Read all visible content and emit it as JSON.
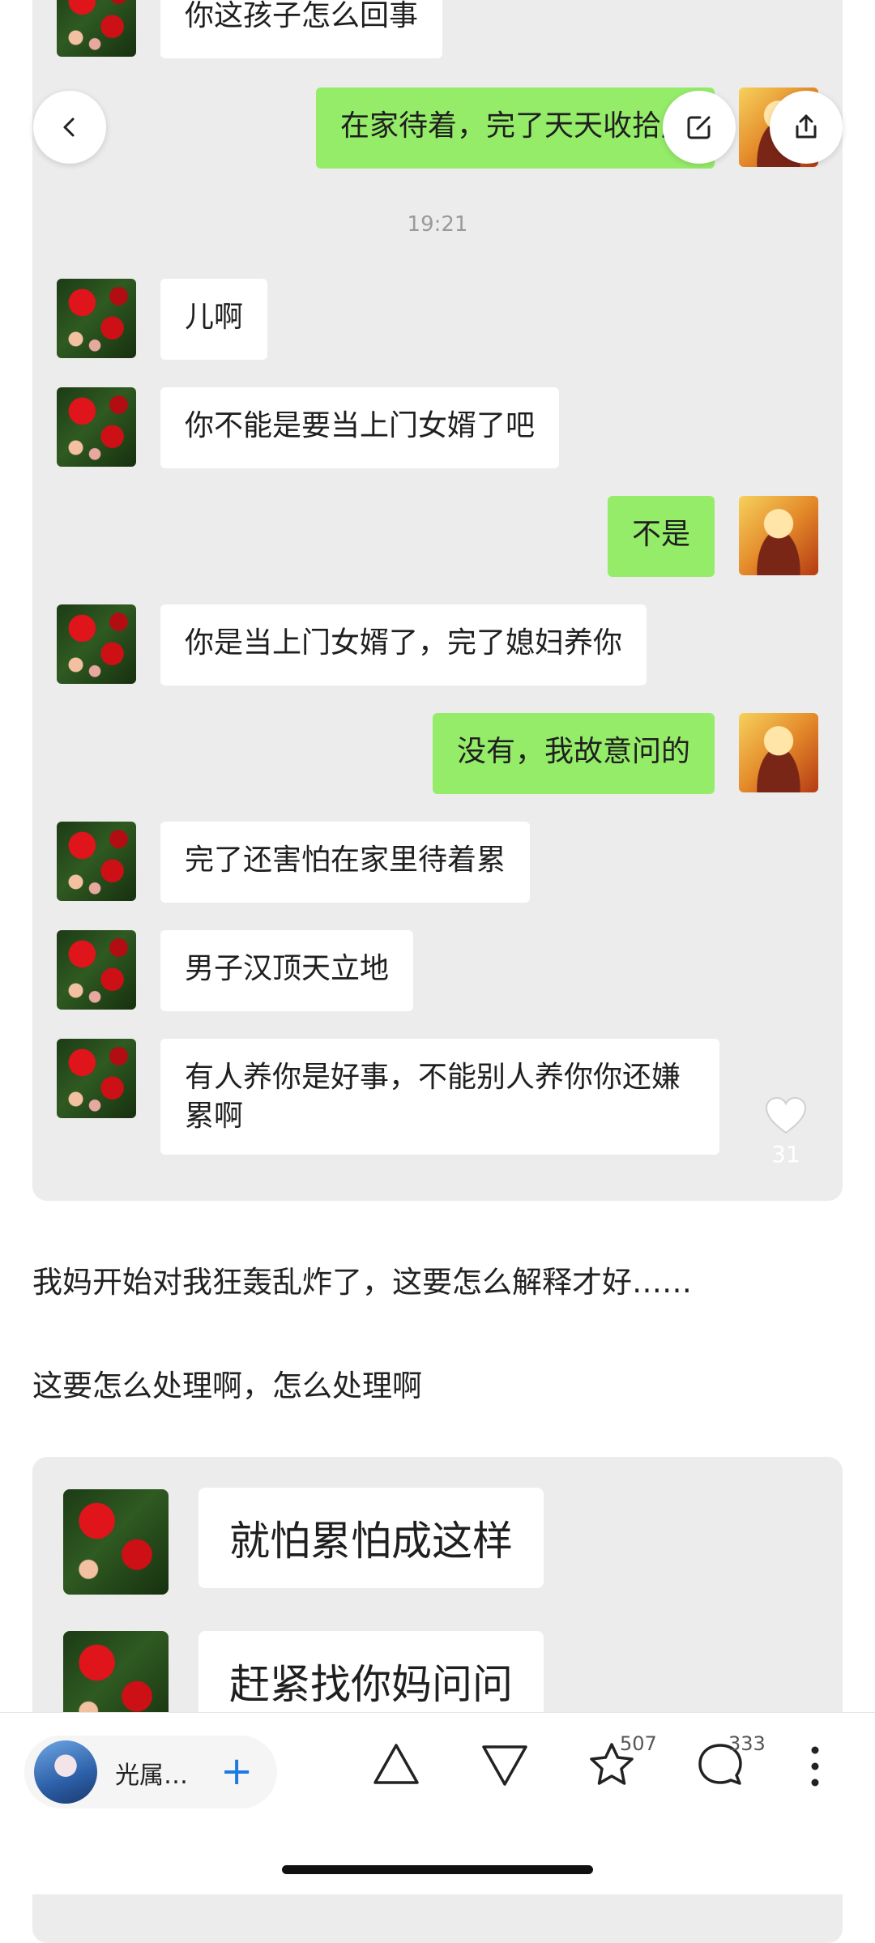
{
  "chat1": {
    "messages": [
      {
        "side": "left",
        "text": "你这孩子怎么回事"
      },
      {
        "side": "right",
        "text": "在家待着，完了天天收拾房"
      },
      {
        "side": "left",
        "text": "儿啊"
      },
      {
        "side": "left",
        "text": "你不能是要当上门女婿了吧"
      },
      {
        "side": "right",
        "text": "不是"
      },
      {
        "side": "left",
        "text": "你是当上门女婿了，完了媳妇养你"
      },
      {
        "side": "right",
        "text": "没有，我故意问的"
      },
      {
        "side": "left",
        "text": "完了还害怕在家里待着累"
      },
      {
        "side": "left",
        "text": "男子汉顶天立地"
      },
      {
        "side": "left",
        "text": "有人养你是好事，不能别人养你你还嫌累啊"
      }
    ],
    "timestamp": "19:21"
  },
  "image_overlay": {
    "like_count": "31"
  },
  "post": {
    "paragraph1": "我妈开始对我狂轰乱炸了，这要怎么解释才好……",
    "paragraph2": "这要怎么处理啊，怎么处理啊"
  },
  "chat2": {
    "messages": [
      {
        "side": "left",
        "text": "就怕累怕成这样"
      },
      {
        "side": "left",
        "text": "赶紧找你妈问问"
      }
    ]
  },
  "bottom_bar": {
    "author_name": "光属…",
    "follow_symbol": "+",
    "favorite_count": "507",
    "comment_count": "333"
  },
  "icons": [
    "back-icon",
    "edit-icon",
    "share-icon",
    "heart-icon",
    "upvote-icon",
    "downvote-icon",
    "star-icon",
    "comment-icon",
    "more-icon"
  ],
  "colors": {
    "wechat_green": "#95ec69",
    "chat_bg": "#ececec",
    "accent_blue": "#1f7ae0"
  }
}
